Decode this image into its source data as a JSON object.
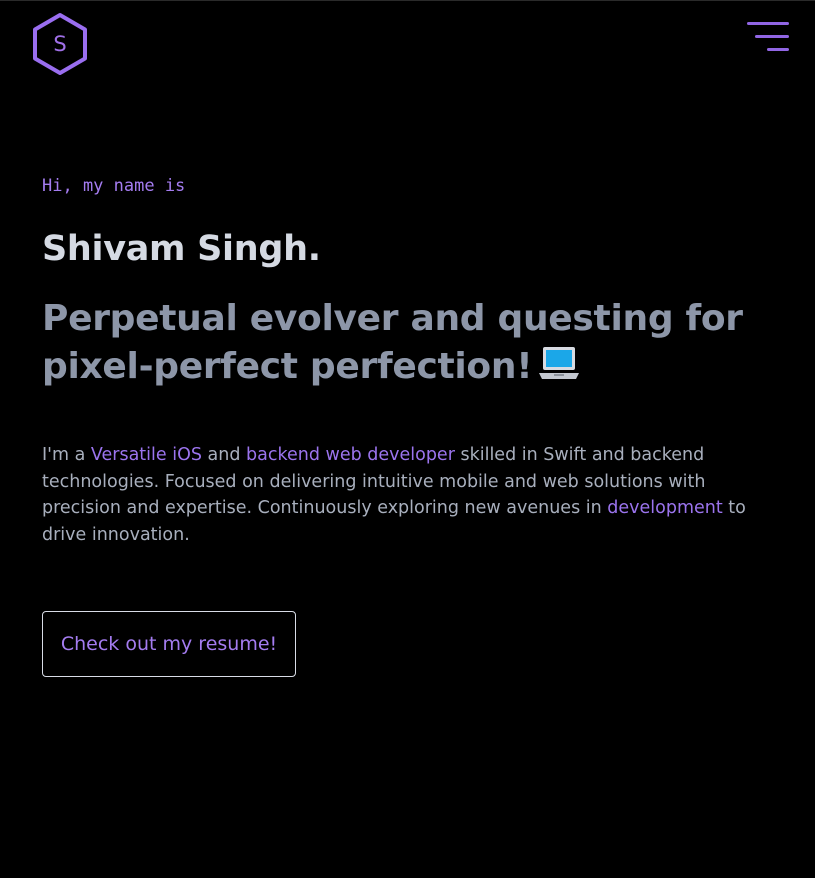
{
  "header": {
    "logo_letter": "S",
    "logo_icon": "hexagon-logo",
    "menu_icon": "hamburger-menu-icon"
  },
  "hero": {
    "intro": "Hi, my name is",
    "name": "Shivam Singh.",
    "tagline": "Perpetual evolver and questing for pixel-perfect perfection!",
    "tagline_emoji_icon": "laptop-icon",
    "bio": {
      "t1": "I'm a ",
      "l1": "Versatile iOS",
      "t2": " and ",
      "l2": "backend web developer",
      "t3": " skilled in Swift and backend technologies. Focused on delivering intuitive mobile and web solutions with precision and expertise. Continuously exploring new avenues in ",
      "l3": "development",
      "t4": " to drive innovation."
    },
    "resume_button": "Check out my resume!"
  },
  "colors": {
    "background": "#000000",
    "accent": "#a47cf0",
    "heading": "#d5dae3",
    "subheading": "#8d96a8",
    "body_text": "#a8afbd"
  }
}
